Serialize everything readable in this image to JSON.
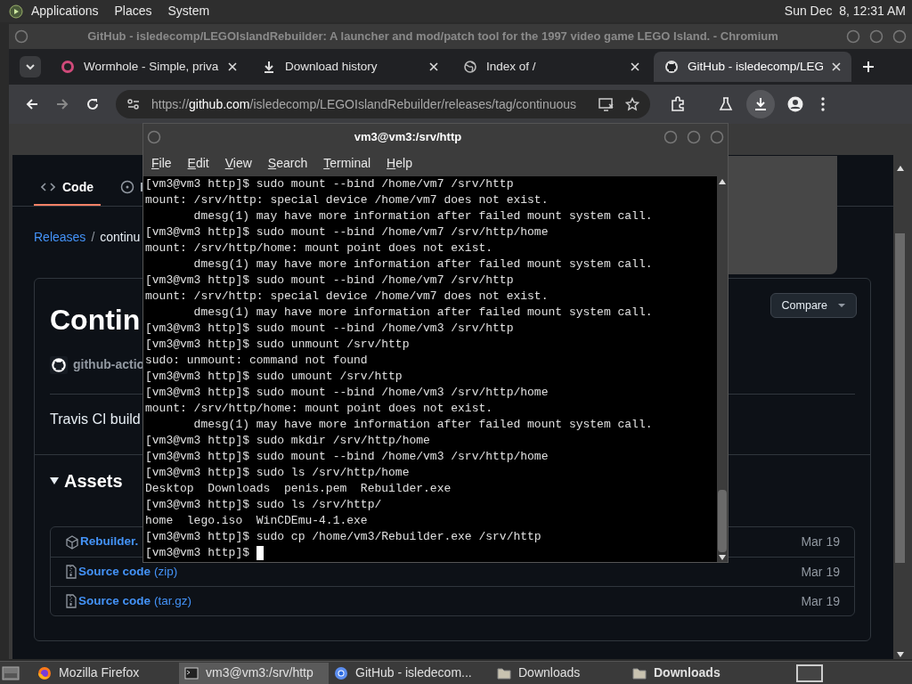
{
  "top_panel": {
    "menus": [
      "Applications",
      "Places",
      "System"
    ],
    "clock": "Sun Dec  8, 12:31 AM"
  },
  "browser": {
    "title": "GitHub - isledecomp/LEGOIslandRebuilder: A launcher and mod/patch tool for the 1997 video game LEGO Island. - Chromium",
    "tabs": [
      {
        "label": "Wormhole - Simple, priva",
        "kind": "wormhole",
        "selected": false
      },
      {
        "label": "Download history",
        "kind": "download",
        "selected": false
      },
      {
        "label": "Index of /",
        "kind": "globe",
        "selected": false
      },
      {
        "label": "GitHub - isledecomp/LEG",
        "kind": "github",
        "selected": true
      }
    ],
    "url": {
      "scheme": "https://",
      "host": "github.com",
      "path": "/isledecomp/LEGOIslandRebuilder/releases/tag/continuous"
    },
    "github": {
      "nav_tabs": [
        {
          "label": "Code",
          "kind": "code",
          "selected": true
        },
        {
          "label": "I",
          "kind": "issues",
          "selected": false
        }
      ],
      "breadcrumb": {
        "link": "Releases",
        "separator": "/",
        "current": "continu"
      },
      "release": {
        "title": "Contin",
        "author": "github-actio",
        "compare": "Compare",
        "body": "Travis CI build",
        "assets_heading": "Assets",
        "assets": [
          {
            "name": "Rebuilder.",
            "kind": "package",
            "date": "Mar 19"
          },
          {
            "name": "Source code",
            "suffix": "(zip)",
            "kind": "zip",
            "date": "Mar 19"
          },
          {
            "name": "Source code",
            "suffix": "(tar.gz)",
            "kind": "zip",
            "date": "Mar 19"
          }
        ]
      }
    }
  },
  "terminal": {
    "title": "vm3@vm3:/srv/http",
    "menus": [
      "File",
      "Edit",
      "View",
      "Search",
      "Terminal",
      "Help"
    ],
    "cursor_visible": true,
    "lines": [
      "[vm3@vm3 http]$ sudo mount --bind /home/vm7 /srv/http",
      "mount: /srv/http: special device /home/vm7 does not exist.",
      "       dmesg(1) may have more information after failed mount system call.",
      "[vm3@vm3 http]$ sudo mount --bind /home/vm7 /srv/http/home",
      "mount: /srv/http/home: mount point does not exist.",
      "       dmesg(1) may have more information after failed mount system call.",
      "[vm3@vm3 http]$ sudo mount --bind /home/vm7 /srv/http",
      "mount: /srv/http: special device /home/vm7 does not exist.",
      "       dmesg(1) may have more information after failed mount system call.",
      "[vm3@vm3 http]$ sudo mount --bind /home/vm3 /srv/http",
      "[vm3@vm3 http]$ sudo unmount /srv/http",
      "sudo: unmount: command not found",
      "[vm3@vm3 http]$ sudo umount /srv/http",
      "[vm3@vm3 http]$ sudo mount --bind /home/vm3 /srv/http/home",
      "mount: /srv/http/home: mount point does not exist.",
      "       dmesg(1) may have more information after failed mount system call.",
      "[vm3@vm3 http]$ sudo mkdir /srv/http/home",
      "[vm3@vm3 http]$ sudo mount --bind /home/vm3 /srv/http/home",
      "[vm3@vm3 http]$ sudo ls /srv/http/home",
      "Desktop  Downloads  penis.pem  Rebuilder.exe",
      "[vm3@vm3 http]$ sudo ls /srv/http/",
      "home  lego.iso  WinCDEmu-4.1.exe",
      "[vm3@vm3 http]$ sudo cp /home/vm3/Rebuilder.exe /srv/http",
      "[vm3@vm3 http]$ "
    ]
  },
  "taskbar": [
    {
      "label": "Mozilla Firefox",
      "kind": "firefox",
      "selected": false,
      "bold": false
    },
    {
      "label": "vm3@vm3:/srv/http",
      "kind": "terminal",
      "selected": true,
      "bold": false
    },
    {
      "label": "GitHub - isledecom...",
      "kind": "chromium",
      "selected": false,
      "bold": false
    },
    {
      "label": "Downloads",
      "kind": "folder",
      "selected": false,
      "bold": false
    },
    {
      "label": "Downloads",
      "kind": "folder",
      "selected": false,
      "bold": true
    }
  ]
}
